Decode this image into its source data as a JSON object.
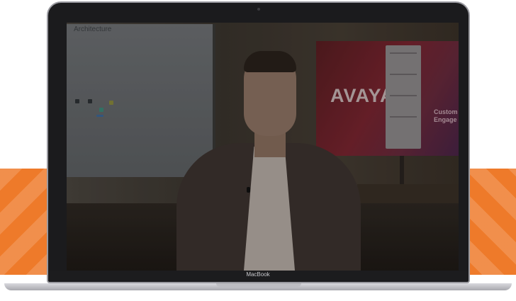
{
  "device": {
    "brand_label": "MacBook"
  },
  "video": {
    "whiteboard_text": "Architecture",
    "panel_brand": "AVAYA",
    "panel_side_line1": "Custom",
    "panel_side_line2": "Engage"
  },
  "colors": {
    "band": "#ee7a2a",
    "bezel": "#1b1b1d",
    "panel": "#7a2530"
  }
}
